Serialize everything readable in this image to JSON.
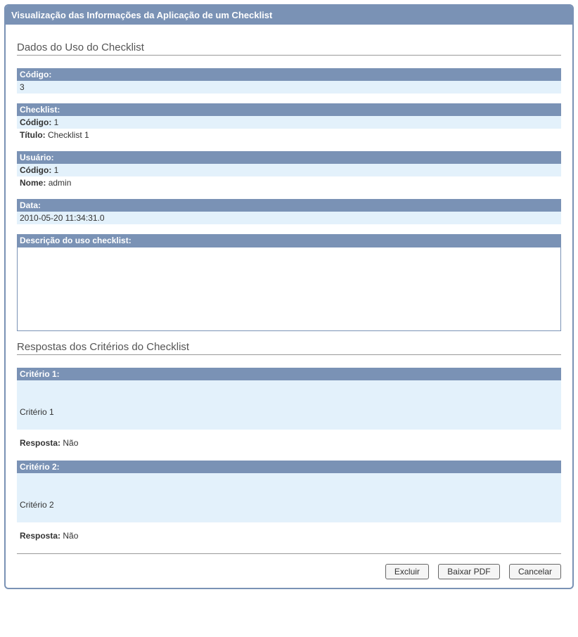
{
  "window": {
    "title": "Visualização das Informações da Aplicação de um Checklist"
  },
  "section1": {
    "title": "Dados do Uso do Checklist",
    "codigo": {
      "header": "Código:",
      "value": "3"
    },
    "checklist": {
      "header": "Checklist:",
      "codigo_label": "Código:",
      "codigo_value": "1",
      "titulo_label": "Título:",
      "titulo_value": "Checklist 1"
    },
    "usuario": {
      "header": "Usuário:",
      "codigo_label": "Código:",
      "codigo_value": "1",
      "nome_label": "Nome:",
      "nome_value": "admin"
    },
    "data": {
      "header": "Data:",
      "value": "2010-05-20 11:34:31.0"
    },
    "descricao": {
      "header": "Descrição do uso checklist:",
      "value": ""
    }
  },
  "section2": {
    "title": "Respostas dos Critérios do Checklist",
    "criterios": [
      {
        "header": "Critério 1:",
        "body": "Critério 1",
        "resposta_label": "Resposta:",
        "resposta_value": "Não"
      },
      {
        "header": "Critério 2:",
        "body": "Critério 2",
        "resposta_label": "Resposta:",
        "resposta_value": "Não"
      }
    ]
  },
  "buttons": {
    "excluir": "Excluir",
    "baixar_pdf": "Baixar PDF",
    "cancelar": "Cancelar"
  }
}
